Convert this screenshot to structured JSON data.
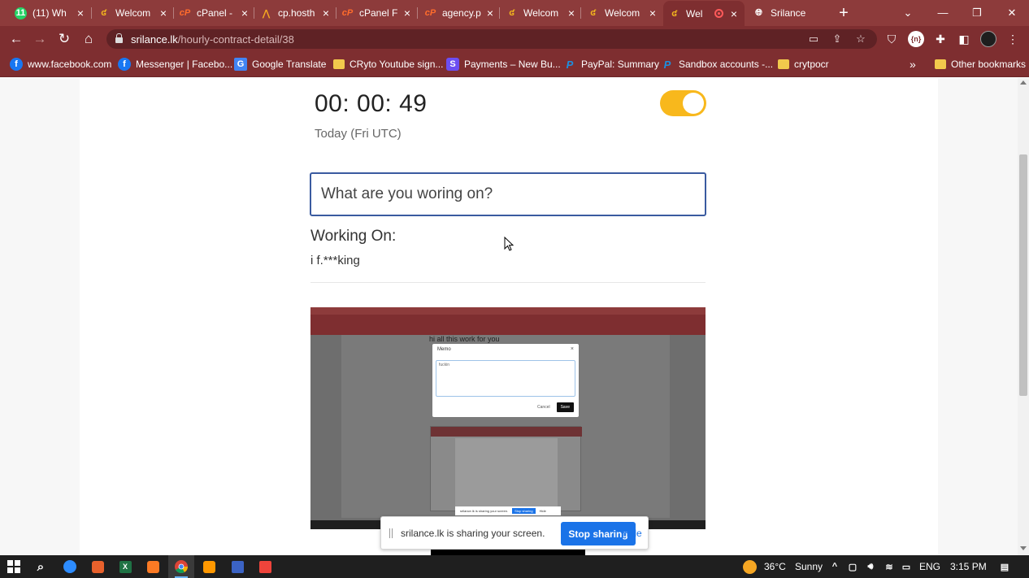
{
  "browser": {
    "tabs": [
      {
        "title": "(11) Wh",
        "icon": "whatsapp-icon",
        "badge": "11"
      },
      {
        "title": "Welcom",
        "icon": "srilance-icon"
      },
      {
        "title": "cPanel -",
        "icon": "cpanel-icon"
      },
      {
        "title": "cp.hosth",
        "icon": "hostinger-icon"
      },
      {
        "title": "cPanel F",
        "icon": "cpanel-icon"
      },
      {
        "title": "agency.p",
        "icon": "cpanel-icon"
      },
      {
        "title": "Welcom",
        "icon": "srilance-icon"
      },
      {
        "title": "Welcom",
        "icon": "srilance-icon"
      },
      {
        "title": "Wel",
        "icon": "srilance-icon",
        "active": true,
        "recording": true
      },
      {
        "title": "Srilance",
        "icon": "globe-icon"
      }
    ],
    "url_host": "srilance.lk",
    "url_path": "/hourly-contract-detail/38",
    "extension_badge": "{n}",
    "bookmarks": [
      {
        "label": "www.facebook.com",
        "icon": "facebook-icon"
      },
      {
        "label": "Messenger | Facebo...",
        "icon": "facebook-icon"
      },
      {
        "label": "Google Translate",
        "icon": "google-translate-icon"
      },
      {
        "label": "CRyto Youtube sign...",
        "icon": "folder-icon"
      },
      {
        "label": "Payments – New Bu...",
        "icon": "stripe-icon"
      },
      {
        "label": "PayPal: Summary",
        "icon": "paypal-icon"
      },
      {
        "label": "Sandbox accounts -...",
        "icon": "paypal-icon"
      },
      {
        "label": "crytpocr",
        "icon": "folder-icon"
      }
    ],
    "bookmarks_more": "»",
    "other_bookmarks": "Other bookmarks"
  },
  "timer": {
    "value": "00: 00: 49",
    "subtitle": "Today (Fri UTC)",
    "toggle_on": true
  },
  "work": {
    "placeholder": "What are you woring on?",
    "working_label": "Working On:",
    "working_value": "i f.***king"
  },
  "thumbnail": {
    "heading_text": "hi all this work for you",
    "memo_title": "Memo",
    "memo_close": "×",
    "memo_text": "fuckin",
    "memo_cancel": "Cancel",
    "memo_save": "Save",
    "share_text": "srilance.lk is sharing your screen.",
    "share_stop": "Stop sharing",
    "share_hide": "Hide"
  },
  "share_banner": {
    "text": "srilance.lk is sharing your screen.",
    "stop_label": "Stop sharing",
    "hide_label": "Hide"
  },
  "taskbar": {
    "weather_temp": "36°C",
    "weather_text": "Sunny",
    "language": "ENG",
    "time": "3:15 PM"
  },
  "colors": {
    "chrome_frame": "#7e2e30",
    "toggle_accent": "#f8b81c",
    "stop_button": "#1a73e8"
  }
}
